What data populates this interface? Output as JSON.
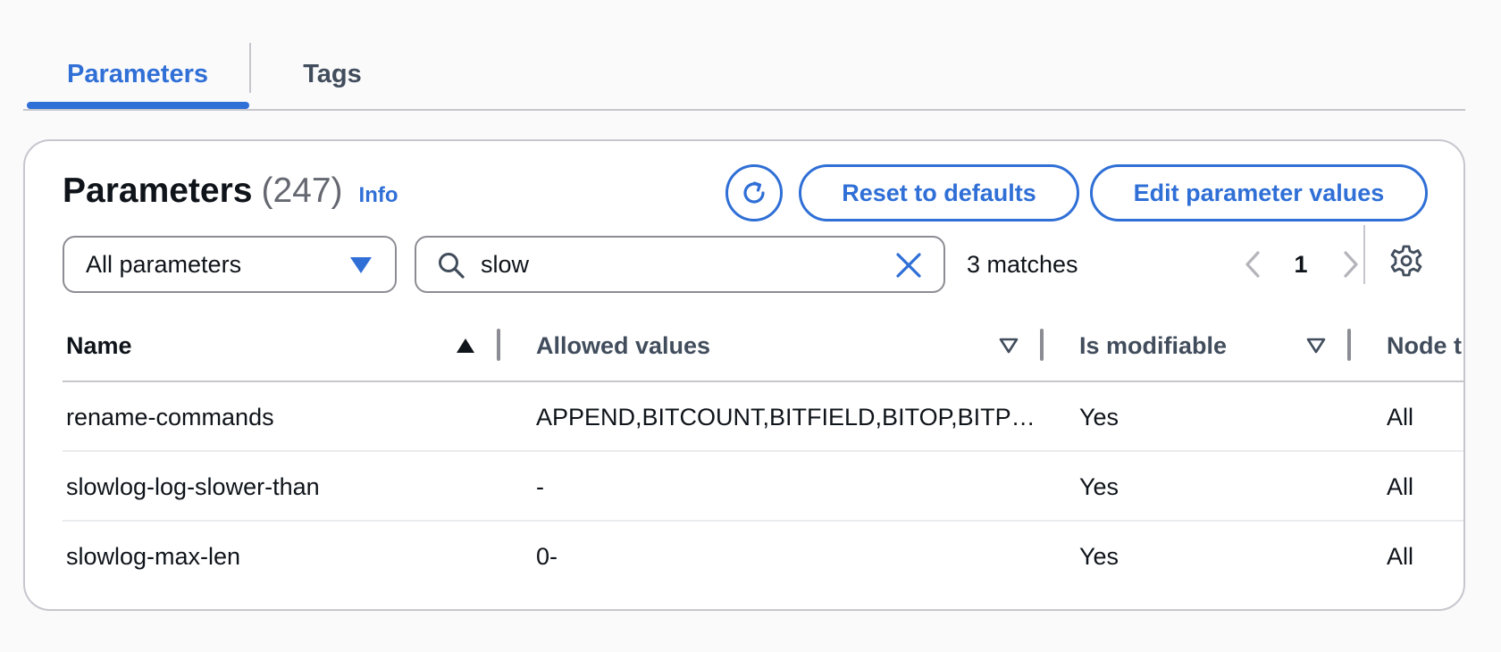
{
  "tabs": [
    {
      "label": "Parameters",
      "active": true
    },
    {
      "label": "Tags",
      "active": false
    }
  ],
  "header": {
    "title": "Parameters",
    "count": "(247)",
    "info": "Info"
  },
  "actions": {
    "refresh_icon": "refresh-icon",
    "reset_label": "Reset to defaults",
    "edit_label": "Edit parameter values"
  },
  "filter": {
    "select_value": "All parameters",
    "search_value": "slow",
    "matches": "3 matches"
  },
  "pagination": {
    "current_page": "1"
  },
  "table": {
    "columns": [
      {
        "label": "Name",
        "sort": "ascending"
      },
      {
        "label": "Allowed values",
        "sort": "none"
      },
      {
        "label": "Is modifiable",
        "sort": "none"
      },
      {
        "label": "Node t"
      }
    ],
    "rows": [
      {
        "name": "rename-commands",
        "allowed": "APPEND,BITCOUNT,BITFIELD,BITOP,BITPOS,BLPOP,BRPOP,BRPOPLPUSH",
        "modifiable": "Yes",
        "node": "All"
      },
      {
        "name": "slowlog-log-slower-than",
        "allowed": "-",
        "modifiable": "Yes",
        "node": "All"
      },
      {
        "name": "slowlog-max-len",
        "allowed": "0-",
        "modifiable": "Yes",
        "node": "All"
      }
    ]
  },
  "colors": {
    "accent": "#2f6fd6",
    "border": "#c6c6cd",
    "text": "#0f141a"
  }
}
